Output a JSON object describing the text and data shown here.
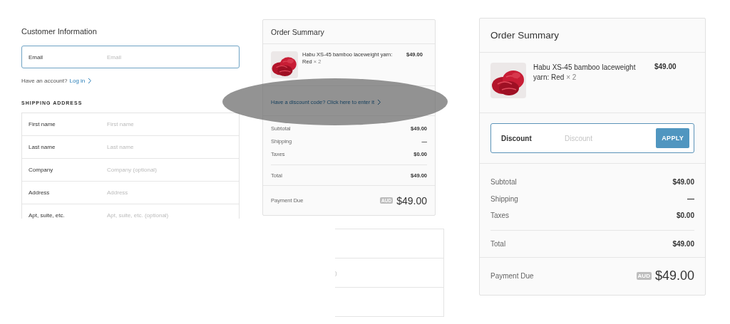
{
  "customer_information": {
    "title": "Customer Information",
    "email": {
      "label": "Email",
      "placeholder": "Email"
    },
    "account_prompt": "Have an account?",
    "login_link": "Log in",
    "shipping_heading": "SHIPPING ADDRESS",
    "fields": [
      {
        "label": "First name",
        "placeholder": "First name"
      },
      {
        "label": "Last name",
        "placeholder": "Last name"
      },
      {
        "label": "Company",
        "placeholder": "Company (optional)"
      },
      {
        "label": "Address",
        "placeholder": "Address"
      },
      {
        "label": "Apt, suite, etc.",
        "placeholder": "Apt, suite, etc. (optional)"
      }
    ]
  },
  "order_summaries": [
    {
      "title": "Order Summary",
      "item": {
        "name": "Habu XS-45 bamboo laceweight yarn: Red",
        "quantity": "× 2",
        "price": "$49.00"
      },
      "discount": {
        "kind": "link",
        "text": "Have a discount code? Click here to enter it"
      },
      "lines": [
        {
          "label": "Subtotal",
          "value": "$49.00"
        },
        {
          "label": "Shipping",
          "value": "—"
        },
        {
          "label": "Taxes",
          "value": "$0.00"
        }
      ],
      "total": {
        "label": "Total",
        "value": "$49.00"
      },
      "payment_due": {
        "label": "Payment Due",
        "currency": "AUD",
        "amount": "$49.00"
      }
    },
    {
      "title": "Order Summary",
      "item": {
        "name": "Habu XS-45 bamboo laceweight yarn: Red",
        "quantity": "× 2",
        "price": "$49.00"
      },
      "discount": {
        "kind": "field",
        "label": "Discount",
        "placeholder": "Discount",
        "button": "APPLY"
      },
      "lines": [
        {
          "label": "Subtotal",
          "value": "$49.00"
        },
        {
          "label": "Shipping",
          "value": "—"
        },
        {
          "label": "Taxes",
          "value": "$0.00"
        }
      ],
      "total": {
        "label": "Total",
        "value": "$49.00"
      },
      "payment_due": {
        "label": "Payment Due",
        "currency": "AUD",
        "amount": "$49.00"
      }
    }
  ],
  "form_fragment": {
    "text": ")"
  }
}
